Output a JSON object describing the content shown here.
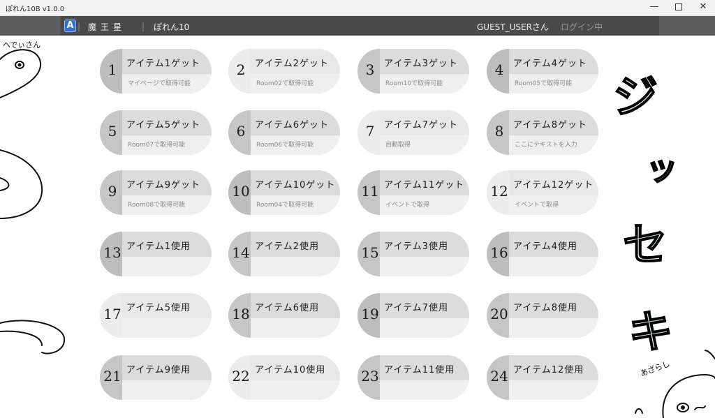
{
  "window": {
    "title": "ぽれん10B v1.0.0",
    "minimize_glyph": "—",
    "close_glyph": "✕"
  },
  "header": {
    "logo_letter": "A",
    "brand": "魔王星",
    "separator": "|",
    "app_name": "ぽれん10",
    "user": "GUEST_USERさん",
    "login": "ログイン中"
  },
  "decor": {
    "top_left_note": "へでぃさん",
    "big_text": [
      "ジ",
      "ッ",
      "セ",
      "キ"
    ],
    "bottom_right_note": "あざらし"
  },
  "buttons": [
    {
      "num": "1",
      "title": "アイテム1ゲット",
      "sub": "マイページで取得可能"
    },
    {
      "num": "2",
      "title": "アイテム2ゲット",
      "sub": "Room02で取得可能"
    },
    {
      "num": "3",
      "title": "アイテム3ゲット",
      "sub": "Room10で取得可能"
    },
    {
      "num": "4",
      "title": "アイテム4ゲット",
      "sub": "Room05で取得可能"
    },
    {
      "num": "5",
      "title": "アイテム5ゲット",
      "sub": "Room07で取得可能"
    },
    {
      "num": "6",
      "title": "アイテム6ゲット",
      "sub": "Room06で取得可能"
    },
    {
      "num": "7",
      "title": "アイテム7ゲット",
      "sub": "自動取得"
    },
    {
      "num": "8",
      "title": "アイテム8ゲット",
      "sub": "ここにテキストを入力"
    },
    {
      "num": "9",
      "title": "アイテム9ゲット",
      "sub": "Room08で取得可能"
    },
    {
      "num": "10",
      "title": "アイテム10ゲット",
      "sub": "Room04で取得可能"
    },
    {
      "num": "11",
      "title": "アイテム11ゲット",
      "sub": "イベントで取得"
    },
    {
      "num": "12",
      "title": "アイテム12ゲット",
      "sub": "イベントで取得"
    },
    {
      "num": "13",
      "title": "アイテム1使用",
      "sub": ""
    },
    {
      "num": "14",
      "title": "アイテム2使用",
      "sub": ""
    },
    {
      "num": "15",
      "title": "アイテム3使用",
      "sub": ""
    },
    {
      "num": "16",
      "title": "アイテム4使用",
      "sub": ""
    },
    {
      "num": "17",
      "title": "アイテム5使用",
      "sub": ""
    },
    {
      "num": "18",
      "title": "アイテム6使用",
      "sub": ""
    },
    {
      "num": "19",
      "title": "アイテム7使用",
      "sub": ""
    },
    {
      "num": "20",
      "title": "アイテム8使用",
      "sub": ""
    },
    {
      "num": "21",
      "title": "アイテム9使用",
      "sub": ""
    },
    {
      "num": "22",
      "title": "アイテム10使用",
      "sub": ""
    },
    {
      "num": "23",
      "title": "アイテム11使用",
      "sub": ""
    },
    {
      "num": "24",
      "title": "アイテム12使用",
      "sub": ""
    }
  ]
}
